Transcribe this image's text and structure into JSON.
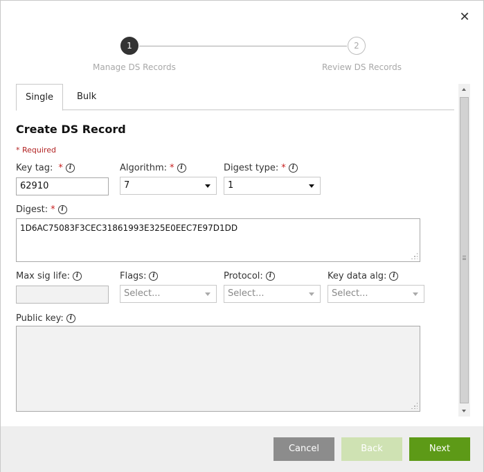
{
  "dialog": {
    "close_glyph": "✕"
  },
  "stepper": {
    "steps": [
      {
        "number": "1",
        "label": "Manage DS Records",
        "active": true
      },
      {
        "number": "2",
        "label": "Review DS Records",
        "active": false
      }
    ]
  },
  "tabs": [
    {
      "label": "Single",
      "selected": true
    },
    {
      "label": "Bulk",
      "selected": false
    }
  ],
  "form": {
    "title": "Create DS Record",
    "required_note": "* Required",
    "required_star": "*",
    "info_glyph": "i",
    "key_tag": {
      "label": "Key tag:",
      "value": "62910"
    },
    "algorithm": {
      "label": "Algorithm:",
      "value": "7"
    },
    "digest_type": {
      "label": "Digest type:",
      "value": "1"
    },
    "digest": {
      "label": "Digest:",
      "value": "1D6AC75083F3CEC31861993E325E0EEC7E97D1DD"
    },
    "max_sig_life": {
      "label": "Max sig life:",
      "value": ""
    },
    "flags": {
      "label": "Flags:",
      "placeholder": "Select..."
    },
    "protocol": {
      "label": "Protocol:",
      "placeholder": "Select..."
    },
    "key_data_alg": {
      "label": "Key data alg:",
      "placeholder": "Select..."
    },
    "public_key": {
      "label": "Public key:",
      "value": ""
    }
  },
  "footer": {
    "cancel_label": "Cancel",
    "back_label": "Back",
    "next_label": "Next"
  },
  "colors": {
    "required": "#c81e1e",
    "next_button": "#5d9a17",
    "back_button_disabled": "#cfe2b3",
    "cancel_button": "#8c8c8c",
    "active_step": "#333333"
  }
}
